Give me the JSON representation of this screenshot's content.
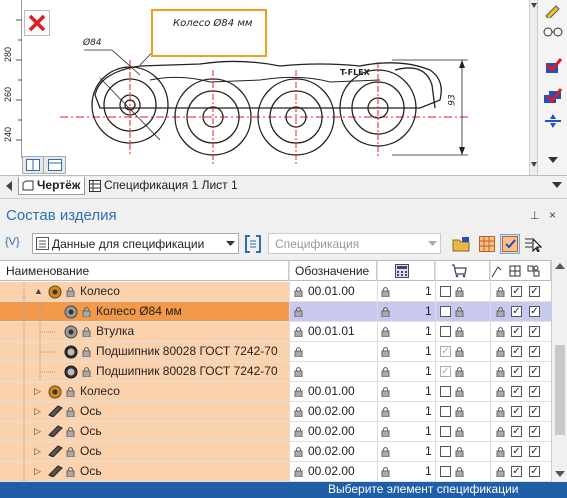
{
  "drawing": {
    "callout_text": "Колесо Ø84 мм",
    "diameter_label": "Ø84",
    "dimension_93": "93",
    "brand_label": "T-FLEX",
    "ruler_ticks": [
      "280",
      "260",
      "240"
    ]
  },
  "tabs": [
    {
      "label": "Чертёж"
    },
    {
      "label": "Спецификация 1 Лист 1"
    }
  ],
  "panel": {
    "title": "Состав изделия",
    "pin": "⊥",
    "close": "×"
  },
  "toolbar": {
    "vars_label": "{V}",
    "dropdown1": "Данные для спецификации",
    "dropdown2": "Спецификация"
  },
  "table": {
    "columns": {
      "name": "Наименование",
      "designation": "Обозначение"
    },
    "rows": [
      {
        "name": "Колесо",
        "designation": "00.01.00",
        "qty": "1"
      },
      {
        "name": "Колесо Ø84 мм",
        "designation": "",
        "qty": "1"
      },
      {
        "name": "Втулка",
        "designation": "00.01.01",
        "qty": "1"
      },
      {
        "name": "Подшипник 80028 ГОСТ 7242-70",
        "designation": "",
        "qty": "1"
      },
      {
        "name": "Подшипник 80028 ГОСТ 7242-70",
        "designation": "",
        "qty": "1"
      },
      {
        "name": "Колесо",
        "designation": "00.01.00",
        "qty": "1"
      },
      {
        "name": "Ось",
        "designation": "00.02.00",
        "qty": "1"
      },
      {
        "name": "Ось",
        "designation": "00.02.00",
        "qty": "1"
      },
      {
        "name": "Ось",
        "designation": "00.02.00",
        "qty": "1"
      },
      {
        "name": "Ось",
        "designation": "00.02.00",
        "qty": "1"
      }
    ]
  },
  "status": {
    "text": "Выберите элемент спецификации"
  },
  "colors": {
    "accent": "#2f6fb3",
    "selection_row": "#c9c8ee",
    "name_bg": "#fcd2ad",
    "selected_name_bg": "#f39a4a",
    "status_bar": "#1e5fa8",
    "callout_border": "#f0a020"
  }
}
